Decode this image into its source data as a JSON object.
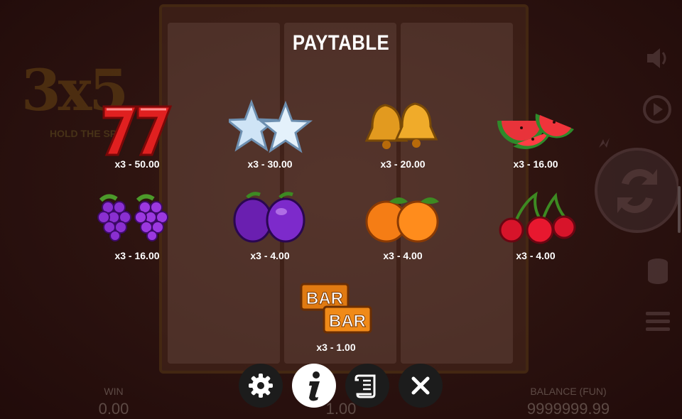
{
  "title": "PAYTABLE",
  "logo": {
    "big": "3x5",
    "sub": "HOLD THE SPIN"
  },
  "symbols": [
    {
      "name": "sevens",
      "payout": "x3 - 50.00"
    },
    {
      "name": "stars",
      "payout": "x3 - 30.00"
    },
    {
      "name": "bells",
      "payout": "x3 - 20.00"
    },
    {
      "name": "watermelons",
      "payout": "x3 - 16.00"
    },
    {
      "name": "grapes",
      "payout": "x3 - 16.00"
    },
    {
      "name": "plums",
      "payout": "x3 - 4.00"
    },
    {
      "name": "oranges",
      "payout": "x3 - 4.00"
    },
    {
      "name": "cherries",
      "payout": "x3 - 4.00"
    },
    {
      "name": "bar",
      "payout": "x3 - 1.00",
      "text": "BAR"
    }
  ],
  "footer": {
    "win_label": "WIN",
    "win_value": "0.00",
    "bet_value": "1.00",
    "balance_label": "BALANCE (FUN)",
    "balance_value": "9999999.99"
  },
  "buttons": [
    "settings-icon",
    "info-icon",
    "history-icon",
    "close-icon"
  ],
  "colors": {
    "accent": "#ffffff",
    "button_dark": "#1c1c1c"
  }
}
